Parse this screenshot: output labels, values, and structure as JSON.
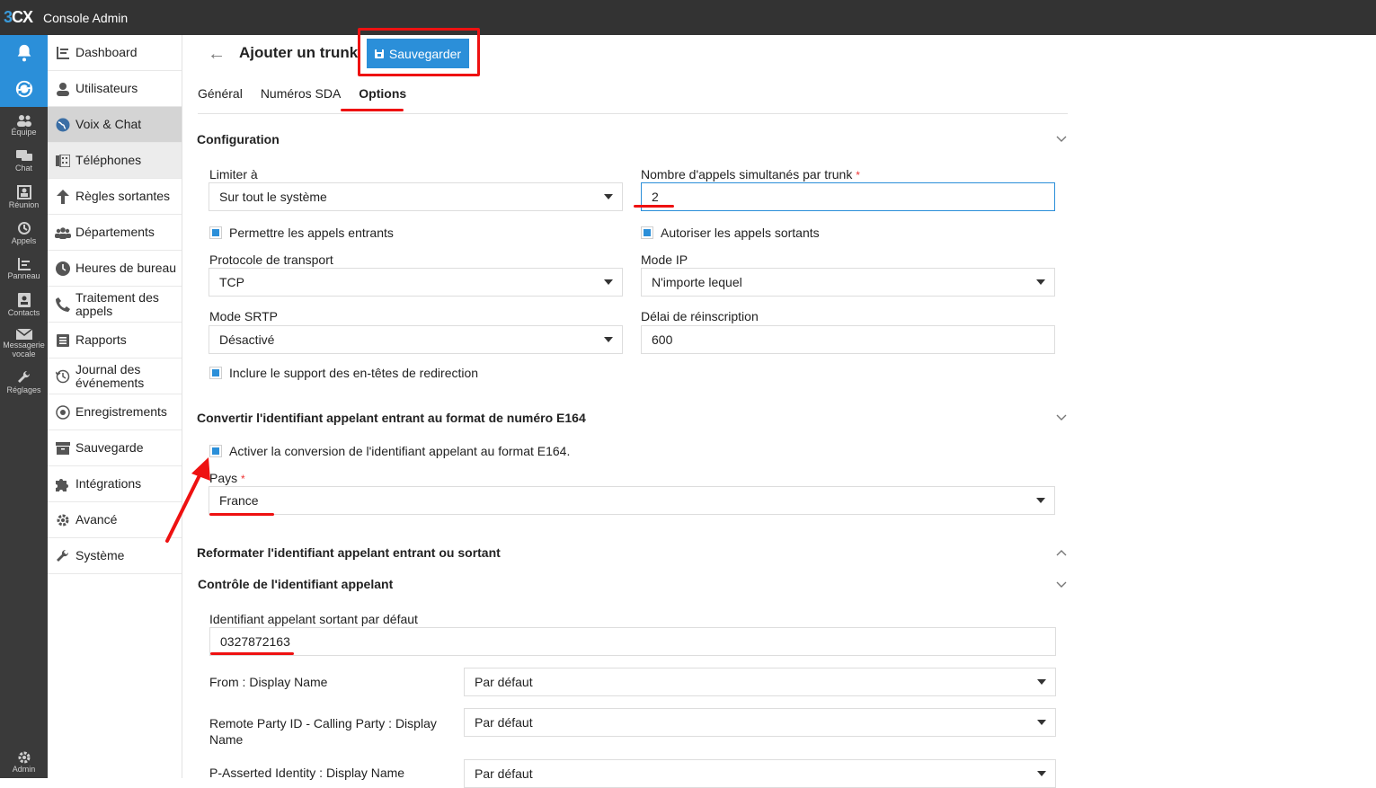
{
  "app": {
    "logo_three": "3",
    "logo_cx": "CX",
    "title": "Console Admin"
  },
  "rail": {
    "items": [
      "Équipe",
      "Chat",
      "Réunion",
      "Appels",
      "Panneau",
      "Contacts",
      "Messagerie vocale",
      "Réglages"
    ],
    "admin": "Admin"
  },
  "sidebar": {
    "items": [
      {
        "label": "Dashboard",
        "icon": "dashboard-icon"
      },
      {
        "label": "Utilisateurs",
        "icon": "user-icon"
      },
      {
        "label": "Voix & Chat",
        "icon": "globe-icon"
      },
      {
        "label": "Téléphones",
        "icon": "phones-icon"
      },
      {
        "label": "Règles sortantes",
        "icon": "arrow-up-icon"
      },
      {
        "label": "Départements",
        "icon": "group-icon"
      },
      {
        "label": "Heures de bureau",
        "icon": "clock-icon"
      },
      {
        "label": "Traitement des appels",
        "icon": "phone-icon"
      },
      {
        "label": "Rapports",
        "icon": "report-icon"
      },
      {
        "label": "Journal des événements",
        "icon": "history-icon"
      },
      {
        "label": "Enregistrements",
        "icon": "record-icon"
      },
      {
        "label": "Sauvegarde",
        "icon": "archive-icon"
      },
      {
        "label": "Intégrations",
        "icon": "puzzle-icon"
      },
      {
        "label": "Avancé",
        "icon": "gear-icon"
      },
      {
        "label": "Système",
        "icon": "wrench-icon"
      }
    ]
  },
  "page": {
    "title": "Ajouter un trunk",
    "save": "Sauvegarder"
  },
  "tabs": [
    "Général",
    "Numéros SDA",
    "Options"
  ],
  "config": {
    "title": "Configuration",
    "limit_label": "Limiter à",
    "limit_value": "Sur tout le système",
    "calls_label": "Nombre d'appels simultanés par trunk",
    "calls_value": "2",
    "allow_in": "Permettre les appels entrants",
    "allow_out": "Autoriser les appels sortants",
    "transport_label": "Protocole de transport",
    "transport_value": "TCP",
    "ipmode_label": "Mode IP",
    "ipmode_value": "N'importe lequel",
    "srtp_label": "Mode SRTP",
    "srtp_value": "Désactivé",
    "reinscription_label": "Délai de réinscription",
    "reinscription_value": "600",
    "redirect": "Inclure le support des en-têtes de redirection"
  },
  "e164": {
    "title": "Convertir l'identifiant appelant entrant au format de numéro E164",
    "enable": "Activer la conversion de l'identifiant appelant au format E164.",
    "country_label": "Pays",
    "country_value": "France"
  },
  "reformat": {
    "title": "Reformater l'identifiant appelant entrant ou sortant"
  },
  "callerid": {
    "title": "Contrôle de l'identifiant appelant",
    "default_label": "Identifiant appelant sortant par défaut",
    "default_value": "0327872163",
    "rows": [
      {
        "label": "From : Display Name",
        "value": "Par défaut"
      },
      {
        "label": "Remote Party ID - Calling Party : Display Name",
        "value": "Par défaut"
      },
      {
        "label": "P-Asserted Identity : Display Name",
        "value": "Par défaut"
      }
    ]
  },
  "required_mark": "*",
  "colors": {
    "accent": "#2b8fd9",
    "topbar": "#333333",
    "rail": "#3a3a3a",
    "annotation": "#ee1111"
  }
}
